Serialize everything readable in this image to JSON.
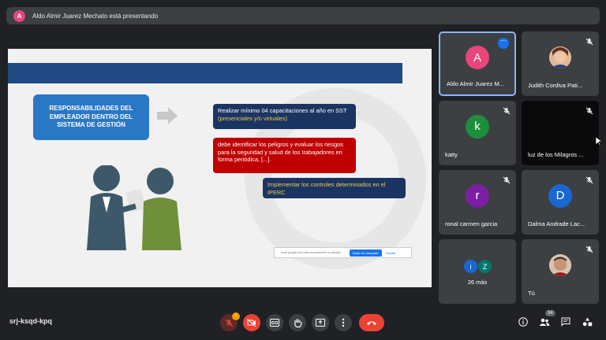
{
  "presenting": {
    "avatar_letter": "A",
    "text": "Aldo Almir Juarez Mechato está presentando"
  },
  "slide": {
    "responsibility_title": "RESPONSABILIDADES DEL EMPLEADOR DENTRO DEL SISTEMA DE GESTIÓN",
    "box1_text": "Realizar mínimo 04 capacitaciones al año en SST",
    "box1_highlight": "(presenciales y/o virtuales)",
    "box2_text": "debe identificar los peligros y evaluar los riesgos para la seguridad y salud de los trabajadores en forma periódica, [...].",
    "box3_text": "Implementar los controles determinados en el IPERC",
    "share_text": "meet.google.com está compartiendo tu pantalla.",
    "share_stop": "Dejar de compartir",
    "share_hide": "Ocultar"
  },
  "participants": [
    {
      "name": "Aldo Almir Juarez M...",
      "letter": "A",
      "color": "#e8457a"
    },
    {
      "name": "Judith Cordiva Pati..."
    },
    {
      "name": "katty",
      "letter": "k",
      "color": "#1e8e3e"
    },
    {
      "name": "luz de los Milagros ..."
    },
    {
      "name": "ronal carmen garcia",
      "letter": "r",
      "color": "#7b1fa2"
    },
    {
      "name": "Dalma Andrade Lac...",
      "letter": "D",
      "color": "#1967d2"
    },
    {
      "name": "26 más",
      "letters": [
        "i",
        "Z"
      ],
      "colors": [
        "#1967d2",
        "#00796b"
      ]
    },
    {
      "name": "Tú"
    }
  ],
  "bottom": {
    "meeting_code": "srj-ksqd-kpq",
    "mic_badge": "!",
    "people_count": "34"
  },
  "colors": {
    "background": "#202124",
    "tile": "#3c4043",
    "accent": "#8ab4f8",
    "hangup": "#ea4335"
  }
}
